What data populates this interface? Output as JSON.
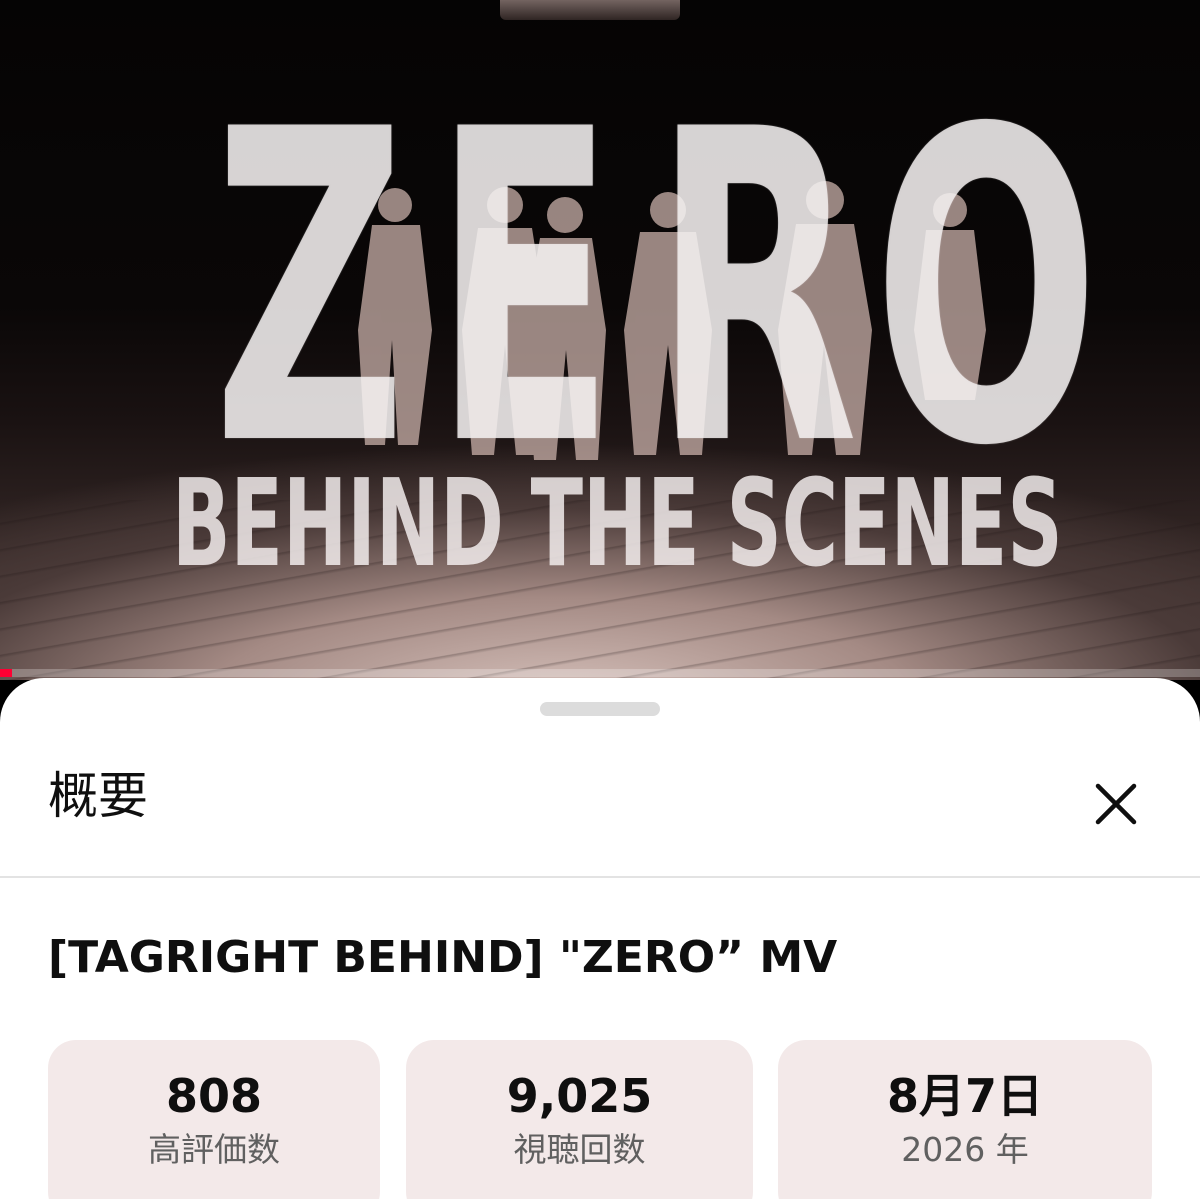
{
  "video": {
    "title_art_letters": [
      "Z",
      "E",
      "R",
      "O"
    ],
    "subtitle_art": "BEHIND THE SCENES",
    "progress_fraction": 0.01
  },
  "sheet": {
    "title": "概要",
    "close_icon": "close-icon",
    "video_title": "[TAGRIGHT BEHIND] \"ZERO” MV",
    "stats": [
      {
        "value": "808",
        "label": "高評価数"
      },
      {
        "value": "9,025",
        "label": "視聴回数"
      },
      {
        "value": "8月7日",
        "label": "2026 年"
      }
    ]
  },
  "colors": {
    "progress": "#ff0033",
    "card_background": "#f3e9e9",
    "sheet_background": "#ffffff"
  }
}
